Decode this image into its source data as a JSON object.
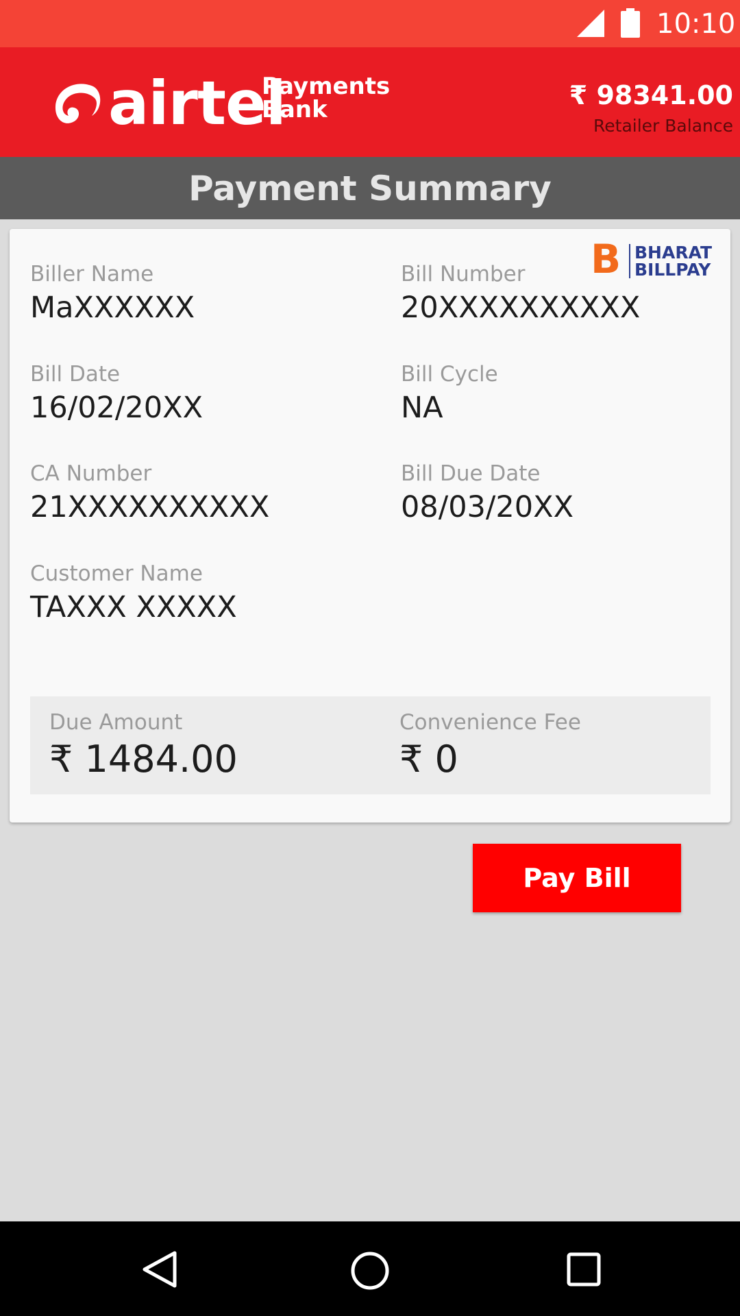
{
  "status_bar": {
    "time": "10:10"
  },
  "header": {
    "logo_word": "airtel",
    "logo_sub_line1": "Payments",
    "logo_sub_line2": "Bank",
    "balance_amount": "₹ 98341.00",
    "balance_label": "Retailer Balance",
    "brand_color": "#e91c24"
  },
  "title": "Payment Summary",
  "bbps": {
    "letter": "B",
    "line1": "BHARAT",
    "line2": "BILLPAY"
  },
  "fields": {
    "biller_name": {
      "label": "Biller Name",
      "value": "MaXXXXXX"
    },
    "bill_number": {
      "label": "Bill Number",
      "value": "20XXXXXXXXXX"
    },
    "bill_date": {
      "label": "Bill Date",
      "value": "16/02/20XX"
    },
    "bill_cycle": {
      "label": "Bill Cycle",
      "value": "NA"
    },
    "ca_number": {
      "label": "CA Number",
      "value": "21XXXXXXXXXX"
    },
    "bill_due_date": {
      "label": "Bill Due Date",
      "value": "08/03/20XX"
    },
    "customer_name": {
      "label": "Customer Name",
      "value": "TAXXX XXXXX"
    }
  },
  "amounts": {
    "due_amount": {
      "label": "Due Amount",
      "value": "₹ 1484.00"
    },
    "convenience_fee": {
      "label": "Convenience Fee",
      "value": "₹ 0"
    }
  },
  "pay_button_label": "Pay Bill",
  "nav": {
    "icons": [
      "back-icon",
      "home-icon",
      "recents-icon"
    ]
  }
}
